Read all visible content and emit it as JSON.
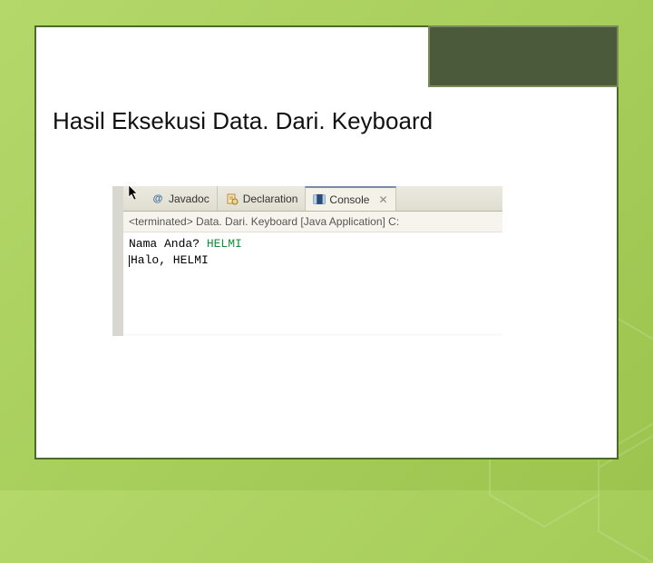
{
  "slide": {
    "title": "Hasil Eksekusi Data. Dari. Keyboard"
  },
  "tabs": {
    "javadoc": "Javadoc",
    "declaration": "Declaration",
    "console": "Console"
  },
  "status": "<terminated> Data. Dari. Keyboard [Java Application] C:",
  "console": {
    "prompt1": "Nama Anda? ",
    "input1": "HELMI",
    "line2": "Halo, HELMI"
  }
}
